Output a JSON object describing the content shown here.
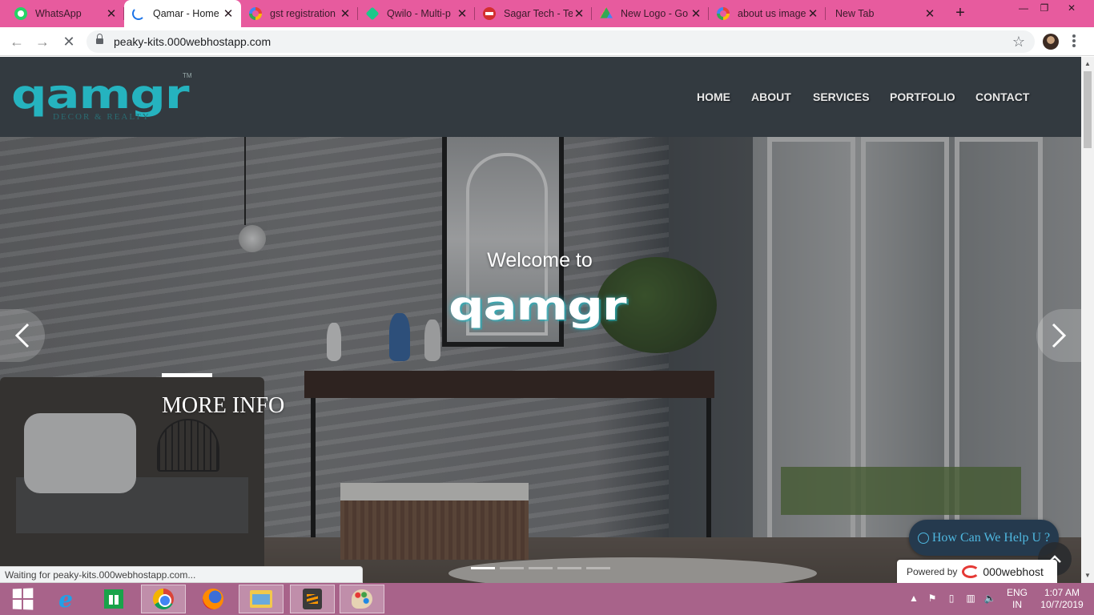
{
  "browser": {
    "tabs": [
      {
        "title": "WhatsApp",
        "icon": "whatsapp-icon",
        "active": false
      },
      {
        "title": "Qamar - Home",
        "icon": "loading-spinner-icon",
        "active": true
      },
      {
        "title": "gst registration",
        "icon": "google-icon",
        "active": false
      },
      {
        "title": "Qwilo - Multi-p",
        "icon": "qwilo-icon",
        "active": false
      },
      {
        "title": "Sagar Tech - Te",
        "icon": "sagar-tech-icon",
        "active": false
      },
      {
        "title": "New Logo - Go",
        "icon": "google-drive-icon",
        "active": false
      },
      {
        "title": "about us image",
        "icon": "google-icon",
        "active": false
      },
      {
        "title": "New Tab",
        "icon": "",
        "active": false
      }
    ],
    "new_tab_label": "+",
    "url": "peaky-kits.000webhostapp.com",
    "status_text": "Waiting for peaky-kits.000webhostapp.com..."
  },
  "site": {
    "logo_text": "qamgr",
    "logo_tagline": "DECOR & REALTY",
    "logo_tm": "TM",
    "nav": [
      "HOME",
      "ABOUT",
      "SERVICES",
      "PORTFOLIO",
      "CONTACT"
    ],
    "hero": {
      "welcome": "Welcome to",
      "logo_text": "qamgr",
      "more_info": "MORE INFO",
      "slide_count": 5,
      "active_slide": 1
    },
    "help_button": "How Can We Help U ?",
    "powered_by": "Powered by",
    "powered_brand": "000webhost"
  },
  "taskbar": {
    "apps": [
      "start",
      "internet-explorer",
      "store",
      "chrome",
      "firefox",
      "file-explorer",
      "sublime-text",
      "paint"
    ],
    "active_app": "chrome",
    "language_line1": "ENG",
    "language_line2": "IN",
    "time": "1:07 AM",
    "date": "10/7/2019"
  },
  "colors": {
    "tab_bar": "#e75b9e",
    "header_bg": "#333a40",
    "brand_teal": "#25b3bf",
    "taskbar": "#a8638a"
  }
}
